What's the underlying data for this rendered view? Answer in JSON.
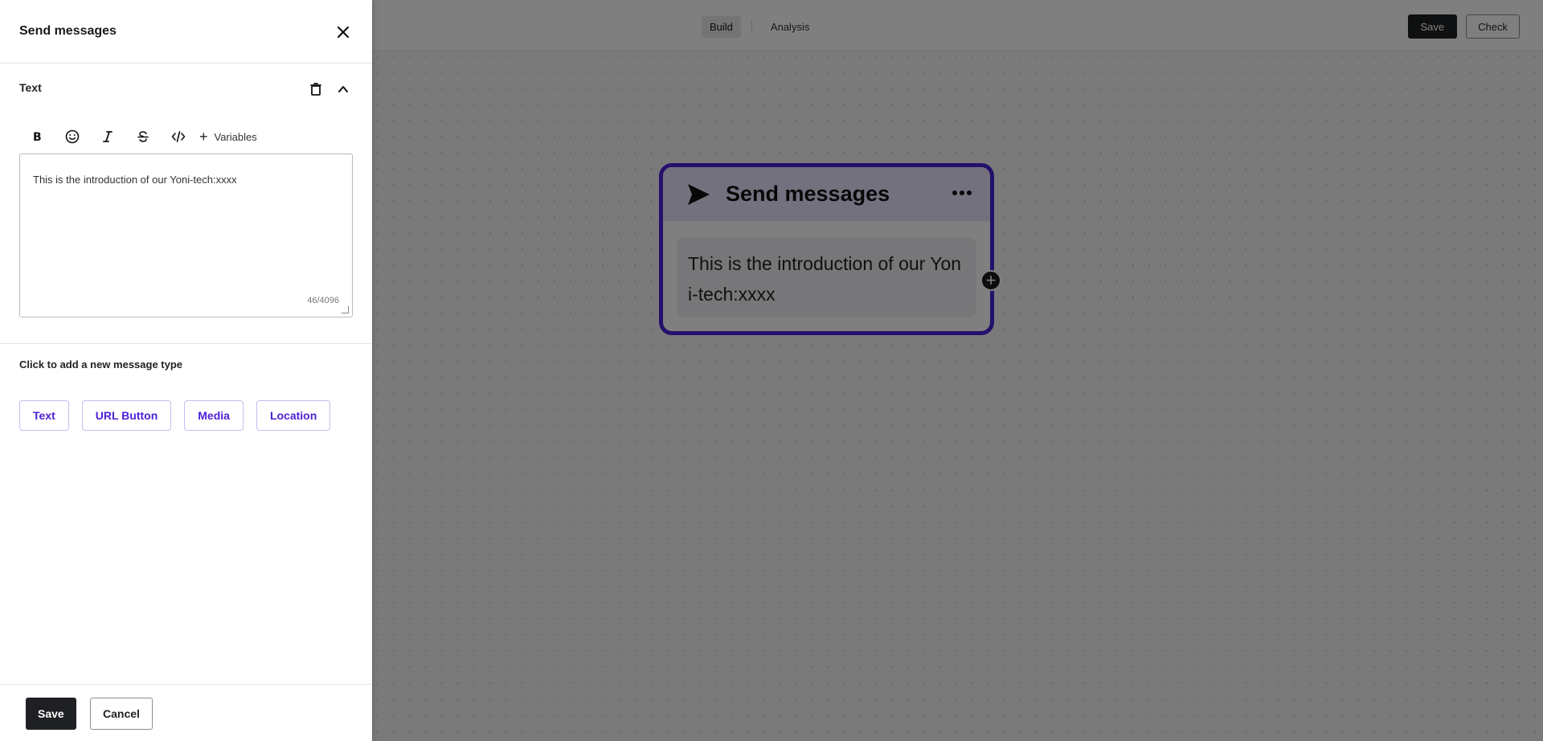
{
  "topbar": {
    "tabs": [
      {
        "label": "Build",
        "active": true
      },
      {
        "label": "Analysis",
        "active": false
      }
    ],
    "save_label": "Save",
    "check_label": "Check"
  },
  "node": {
    "title": "Send messages",
    "icon": "send-icon",
    "message": "This is the introduction of our Yoni-tech:xxxx",
    "accent_color": "#4b22d6"
  },
  "panel": {
    "title": "Send messages",
    "section_title": "Text",
    "toolbar": {
      "buttons": [
        "bold-icon",
        "emoji-icon",
        "italic-icon",
        "strikethrough-icon",
        "code-icon"
      ],
      "variables_label": "Variables"
    },
    "editor_text": "This is the introduction of our Yoni-tech:xxxx",
    "counter": "46/4096",
    "add_type_label": "Click to add a new message type",
    "message_types": [
      "Text",
      "URL Button",
      "Media",
      "Location"
    ],
    "save_label": "Save",
    "cancel_label": "Cancel"
  }
}
